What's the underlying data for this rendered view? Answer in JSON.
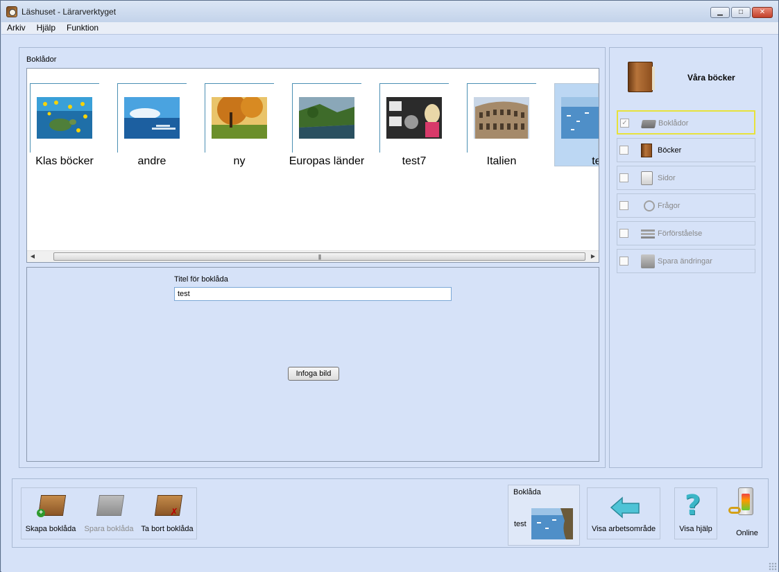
{
  "window": {
    "title": "Läshuset - Lärarverktyget",
    "controls": {
      "minimize": "▁",
      "maximize": "□",
      "close": "✕"
    }
  },
  "menu": [
    "Arkiv",
    "Hjälp",
    "Funktion"
  ],
  "bookboxes": {
    "group_label": "Boklådor",
    "items": [
      {
        "title": "Klas böcker",
        "thumb": "sea turtle underwater"
      },
      {
        "title": "andre",
        "thumb": "ocean sky pier"
      },
      {
        "title": "ny",
        "thumb": "autumn tree"
      },
      {
        "title": "Europas länder",
        "thumb": "green coastline"
      },
      {
        "title": "test7",
        "thumb": "collage with teddy"
      },
      {
        "title": "Italien",
        "thumb": "colosseum"
      },
      {
        "title": "test",
        "thumb": "blue bay",
        "selected": true
      }
    ],
    "scrollbar": {
      "left": "◀",
      "right": "▶",
      "grip": "|||"
    }
  },
  "editor": {
    "title_label": "Titel för boklåda",
    "title_value": "test",
    "insert_image": "Infoga bild"
  },
  "side": {
    "header": "Våra böcker",
    "steps": [
      {
        "label": "Boklådor",
        "checked": true,
        "active": true,
        "enabled": false,
        "icon": "box-icon"
      },
      {
        "label": "Böcker",
        "checked": false,
        "active": false,
        "enabled": true,
        "icon": "book-icon"
      },
      {
        "label": "Sidor",
        "checked": false,
        "active": false,
        "enabled": false,
        "icon": "page-icon"
      },
      {
        "label": "Frågor",
        "checked": false,
        "active": false,
        "enabled": false,
        "icon": "question-icon"
      },
      {
        "label": "Förförståelse",
        "checked": false,
        "active": false,
        "enabled": false,
        "icon": "lines-icon"
      },
      {
        "label": "Spara ändringar",
        "checked": false,
        "active": false,
        "enabled": false,
        "icon": "save-icon"
      }
    ],
    "check_mark": "✓"
  },
  "toolbar": {
    "create": "Skapa boklåda",
    "save": "Spara boklåda",
    "delete": "Ta bort boklåda",
    "current_box_title": "Boklåda",
    "current_box_name": "test",
    "workspace": "Visa arbetsområde",
    "help": "Visa hjälp",
    "online": "Online",
    "help_glyph": "?",
    "plus_glyph": "+",
    "x_glyph": "✗"
  },
  "colors": {
    "accent_frame": "#4a8fb3",
    "active_outline": "#e7e23a",
    "panel_bg": "#d6e2f8"
  }
}
